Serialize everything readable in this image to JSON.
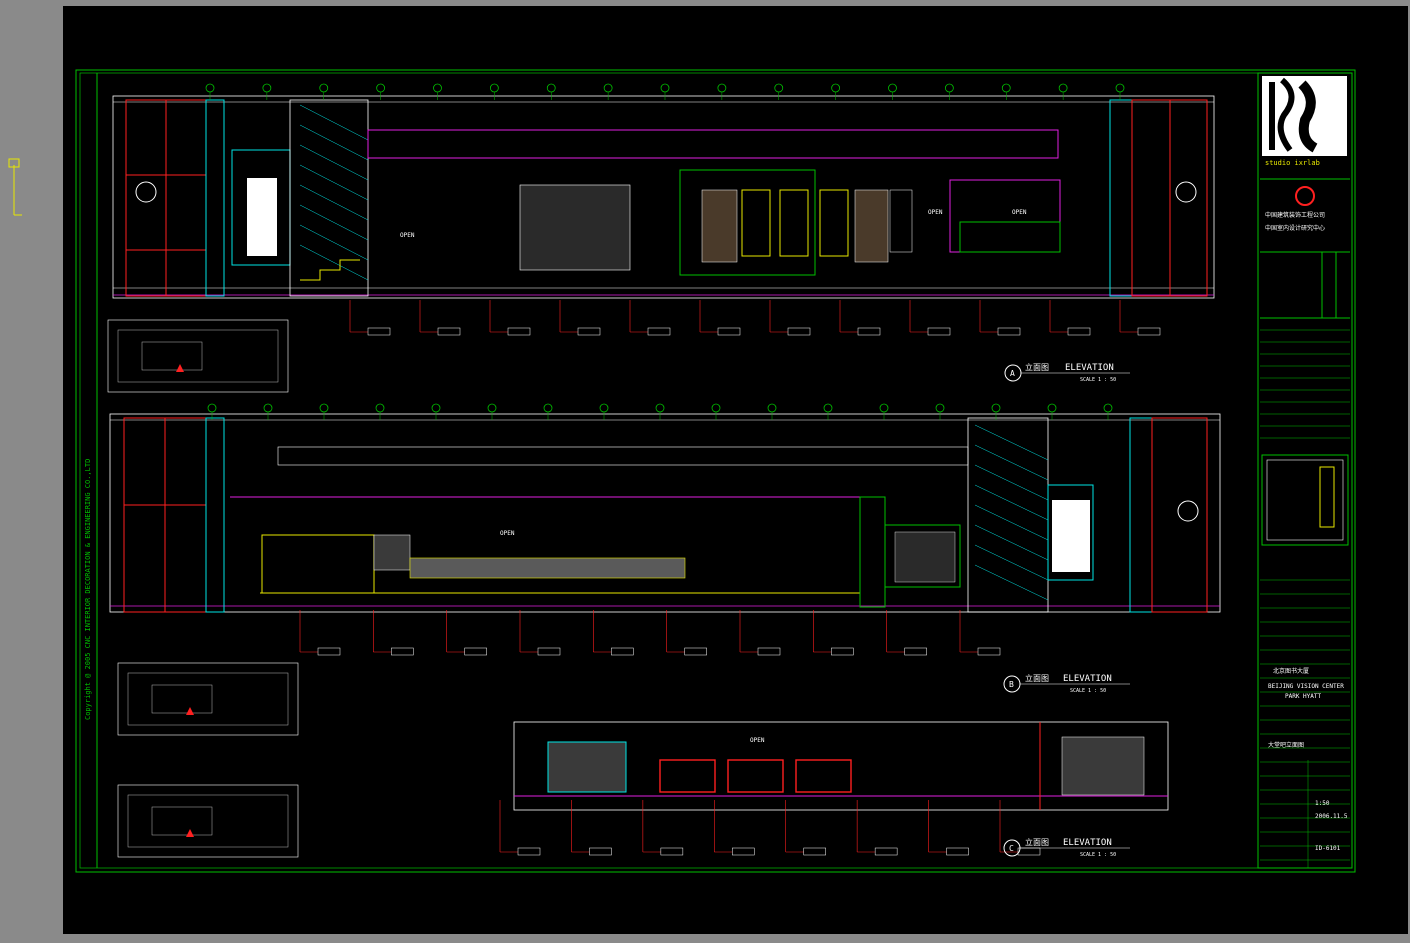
{
  "elevations": [
    {
      "id": "A",
      "title_cn": "立面图",
      "title_en": "ELEVATION",
      "scale": "SCALE 1 : 50"
    },
    {
      "id": "B",
      "title_cn": "立面图",
      "title_en": "ELEVATION",
      "scale": "SCALE 1 : 50"
    },
    {
      "id": "C",
      "title_cn": "立面图",
      "title_en": "ELEVATION",
      "scale": "SCALE 1 : 50"
    }
  ],
  "open_label": "OPEN",
  "copyright_note": "Copyright @ 2005   CNC INTERIOR DECORATION & ENGINEERING CO.,LTD",
  "title_block": {
    "logo_caption": "studio ixrlab",
    "company_cn": "中国建筑装饰工程公司",
    "company_sub_cn": "中国室内设计研究中心",
    "project_name_cn": "北京图书大厦",
    "project_name_en": "BEIJING VISION CENTER",
    "project_sub": "PARK HYATT",
    "drawing_title_cn": "大堂吧立面图",
    "scale_value": "1:50",
    "date_value": "2006.11.5",
    "drawing_no": "ID-6101"
  },
  "colors": {
    "sheet": "#000000",
    "frame": "#00c000",
    "structure": "#ff2020",
    "cyan": "#00e5e5",
    "white": "#ffffff",
    "magenta": "#e020e0",
    "yellow": "#e8e800",
    "workspace": "#8a8a8a"
  }
}
